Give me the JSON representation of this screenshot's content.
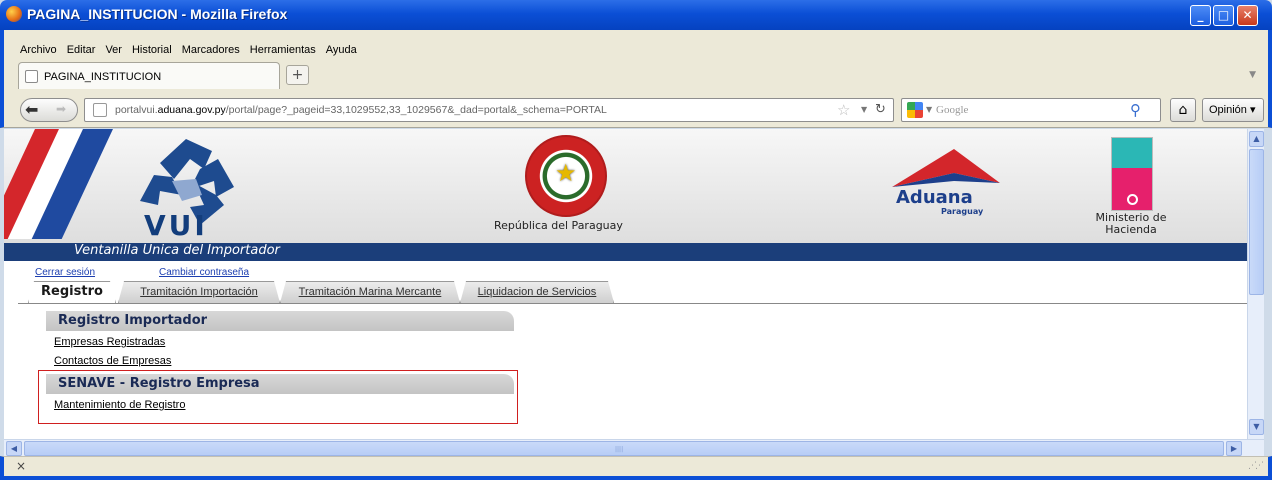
{
  "window": {
    "title": "PAGINA_INSTITUCION - Mozilla Firefox"
  },
  "menu": [
    "Archivo",
    "Editar",
    "Ver",
    "Historial",
    "Marcadores",
    "Herramientas",
    "Ayuda"
  ],
  "browser_tab": {
    "title": "PAGINA_INSTITUCION",
    "new_tab": "+"
  },
  "navbar": {
    "url_host": "portalvui.aduana.gov.py",
    "url_prefix": "portalvui.",
    "url_domain": "aduana.gov.py",
    "url_path": "/portal/page?_pageid=33,1029552,33_1029567&_dad=portal&_schema=PORTAL",
    "search_placeholder": "Google",
    "feedback_button": "Opinión"
  },
  "banner": {
    "logo_text": "VUI",
    "seal_caption": "República del Paraguay",
    "aduana_name": "Aduana",
    "aduana_sub": "Paraguay",
    "ministry_caption": "Ministerio de Hacienda",
    "bar_text": "Ventanilla Unica del Importador"
  },
  "links": {
    "logout": "Cerrar sesión",
    "change_password": "Cambiar contraseña"
  },
  "tabs": [
    {
      "label": "Registro",
      "active": true
    },
    {
      "label": "Tramitación Importación",
      "active": false
    },
    {
      "label": "Tramitación Marina Mercante",
      "active": false
    },
    {
      "label": "Liquidacion de Servicios",
      "active": false
    }
  ],
  "sections": [
    {
      "title": "Registro Importador",
      "links": [
        "Empresas Registradas",
        "Contactos de Empresas"
      ]
    },
    {
      "title": "SENAVE - Registro Empresa",
      "links": [
        "Mantenimiento de Registro"
      ],
      "highlighted": true
    }
  ],
  "colors": {
    "titlebar": "#0b4fd6",
    "banner_bar": "#1b3e7a",
    "highlight_box": "#d01f1f",
    "link": "#1d3fb0"
  },
  "statusbar": {
    "close_symbol": "×"
  }
}
